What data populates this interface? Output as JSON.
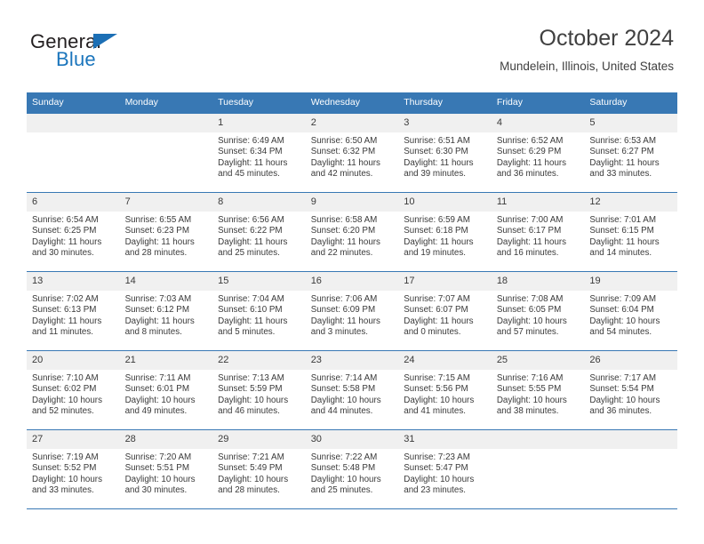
{
  "brand": {
    "name_top": "General",
    "name_bottom": "Blue",
    "triangle_color": "#1c6fb5",
    "blue_color": "#1b75bc"
  },
  "header": {
    "title": "October 2024",
    "subtitle": "Mundelein, Illinois, United States"
  },
  "theme": {
    "header_bg": "#3878b4",
    "daynum_bg": "#f0f0f0",
    "text": "#3a3a3a"
  },
  "weekdays": [
    "Sunday",
    "Monday",
    "Tuesday",
    "Wednesday",
    "Thursday",
    "Friday",
    "Saturday"
  ],
  "weeks": [
    [
      {
        "day": "",
        "sunrise": "",
        "sunset": "",
        "daylight1": "",
        "daylight2": ""
      },
      {
        "day": "",
        "sunrise": "",
        "sunset": "",
        "daylight1": "",
        "daylight2": ""
      },
      {
        "day": "1",
        "sunrise": "Sunrise: 6:49 AM",
        "sunset": "Sunset: 6:34 PM",
        "daylight1": "Daylight: 11 hours",
        "daylight2": "and 45 minutes."
      },
      {
        "day": "2",
        "sunrise": "Sunrise: 6:50 AM",
        "sunset": "Sunset: 6:32 PM",
        "daylight1": "Daylight: 11 hours",
        "daylight2": "and 42 minutes."
      },
      {
        "day": "3",
        "sunrise": "Sunrise: 6:51 AM",
        "sunset": "Sunset: 6:30 PM",
        "daylight1": "Daylight: 11 hours",
        "daylight2": "and 39 minutes."
      },
      {
        "day": "4",
        "sunrise": "Sunrise: 6:52 AM",
        "sunset": "Sunset: 6:29 PM",
        "daylight1": "Daylight: 11 hours",
        "daylight2": "and 36 minutes."
      },
      {
        "day": "5",
        "sunrise": "Sunrise: 6:53 AM",
        "sunset": "Sunset: 6:27 PM",
        "daylight1": "Daylight: 11 hours",
        "daylight2": "and 33 minutes."
      }
    ],
    [
      {
        "day": "6",
        "sunrise": "Sunrise: 6:54 AM",
        "sunset": "Sunset: 6:25 PM",
        "daylight1": "Daylight: 11 hours",
        "daylight2": "and 30 minutes."
      },
      {
        "day": "7",
        "sunrise": "Sunrise: 6:55 AM",
        "sunset": "Sunset: 6:23 PM",
        "daylight1": "Daylight: 11 hours",
        "daylight2": "and 28 minutes."
      },
      {
        "day": "8",
        "sunrise": "Sunrise: 6:56 AM",
        "sunset": "Sunset: 6:22 PM",
        "daylight1": "Daylight: 11 hours",
        "daylight2": "and 25 minutes."
      },
      {
        "day": "9",
        "sunrise": "Sunrise: 6:58 AM",
        "sunset": "Sunset: 6:20 PM",
        "daylight1": "Daylight: 11 hours",
        "daylight2": "and 22 minutes."
      },
      {
        "day": "10",
        "sunrise": "Sunrise: 6:59 AM",
        "sunset": "Sunset: 6:18 PM",
        "daylight1": "Daylight: 11 hours",
        "daylight2": "and 19 minutes."
      },
      {
        "day": "11",
        "sunrise": "Sunrise: 7:00 AM",
        "sunset": "Sunset: 6:17 PM",
        "daylight1": "Daylight: 11 hours",
        "daylight2": "and 16 minutes."
      },
      {
        "day": "12",
        "sunrise": "Sunrise: 7:01 AM",
        "sunset": "Sunset: 6:15 PM",
        "daylight1": "Daylight: 11 hours",
        "daylight2": "and 14 minutes."
      }
    ],
    [
      {
        "day": "13",
        "sunrise": "Sunrise: 7:02 AM",
        "sunset": "Sunset: 6:13 PM",
        "daylight1": "Daylight: 11 hours",
        "daylight2": "and 11 minutes."
      },
      {
        "day": "14",
        "sunrise": "Sunrise: 7:03 AM",
        "sunset": "Sunset: 6:12 PM",
        "daylight1": "Daylight: 11 hours",
        "daylight2": "and 8 minutes."
      },
      {
        "day": "15",
        "sunrise": "Sunrise: 7:04 AM",
        "sunset": "Sunset: 6:10 PM",
        "daylight1": "Daylight: 11 hours",
        "daylight2": "and 5 minutes."
      },
      {
        "day": "16",
        "sunrise": "Sunrise: 7:06 AM",
        "sunset": "Sunset: 6:09 PM",
        "daylight1": "Daylight: 11 hours",
        "daylight2": "and 3 minutes."
      },
      {
        "day": "17",
        "sunrise": "Sunrise: 7:07 AM",
        "sunset": "Sunset: 6:07 PM",
        "daylight1": "Daylight: 11 hours",
        "daylight2": "and 0 minutes."
      },
      {
        "day": "18",
        "sunrise": "Sunrise: 7:08 AM",
        "sunset": "Sunset: 6:05 PM",
        "daylight1": "Daylight: 10 hours",
        "daylight2": "and 57 minutes."
      },
      {
        "day": "19",
        "sunrise": "Sunrise: 7:09 AM",
        "sunset": "Sunset: 6:04 PM",
        "daylight1": "Daylight: 10 hours",
        "daylight2": "and 54 minutes."
      }
    ],
    [
      {
        "day": "20",
        "sunrise": "Sunrise: 7:10 AM",
        "sunset": "Sunset: 6:02 PM",
        "daylight1": "Daylight: 10 hours",
        "daylight2": "and 52 minutes."
      },
      {
        "day": "21",
        "sunrise": "Sunrise: 7:11 AM",
        "sunset": "Sunset: 6:01 PM",
        "daylight1": "Daylight: 10 hours",
        "daylight2": "and 49 minutes."
      },
      {
        "day": "22",
        "sunrise": "Sunrise: 7:13 AM",
        "sunset": "Sunset: 5:59 PM",
        "daylight1": "Daylight: 10 hours",
        "daylight2": "and 46 minutes."
      },
      {
        "day": "23",
        "sunrise": "Sunrise: 7:14 AM",
        "sunset": "Sunset: 5:58 PM",
        "daylight1": "Daylight: 10 hours",
        "daylight2": "and 44 minutes."
      },
      {
        "day": "24",
        "sunrise": "Sunrise: 7:15 AM",
        "sunset": "Sunset: 5:56 PM",
        "daylight1": "Daylight: 10 hours",
        "daylight2": "and 41 minutes."
      },
      {
        "day": "25",
        "sunrise": "Sunrise: 7:16 AM",
        "sunset": "Sunset: 5:55 PM",
        "daylight1": "Daylight: 10 hours",
        "daylight2": "and 38 minutes."
      },
      {
        "day": "26",
        "sunrise": "Sunrise: 7:17 AM",
        "sunset": "Sunset: 5:54 PM",
        "daylight1": "Daylight: 10 hours",
        "daylight2": "and 36 minutes."
      }
    ],
    [
      {
        "day": "27",
        "sunrise": "Sunrise: 7:19 AM",
        "sunset": "Sunset: 5:52 PM",
        "daylight1": "Daylight: 10 hours",
        "daylight2": "and 33 minutes."
      },
      {
        "day": "28",
        "sunrise": "Sunrise: 7:20 AM",
        "sunset": "Sunset: 5:51 PM",
        "daylight1": "Daylight: 10 hours",
        "daylight2": "and 30 minutes."
      },
      {
        "day": "29",
        "sunrise": "Sunrise: 7:21 AM",
        "sunset": "Sunset: 5:49 PM",
        "daylight1": "Daylight: 10 hours",
        "daylight2": "and 28 minutes."
      },
      {
        "day": "30",
        "sunrise": "Sunrise: 7:22 AM",
        "sunset": "Sunset: 5:48 PM",
        "daylight1": "Daylight: 10 hours",
        "daylight2": "and 25 minutes."
      },
      {
        "day": "31",
        "sunrise": "Sunrise: 7:23 AM",
        "sunset": "Sunset: 5:47 PM",
        "daylight1": "Daylight: 10 hours",
        "daylight2": "and 23 minutes."
      },
      {
        "day": "",
        "sunrise": "",
        "sunset": "",
        "daylight1": "",
        "daylight2": ""
      },
      {
        "day": "",
        "sunrise": "",
        "sunset": "",
        "daylight1": "",
        "daylight2": ""
      }
    ]
  ]
}
